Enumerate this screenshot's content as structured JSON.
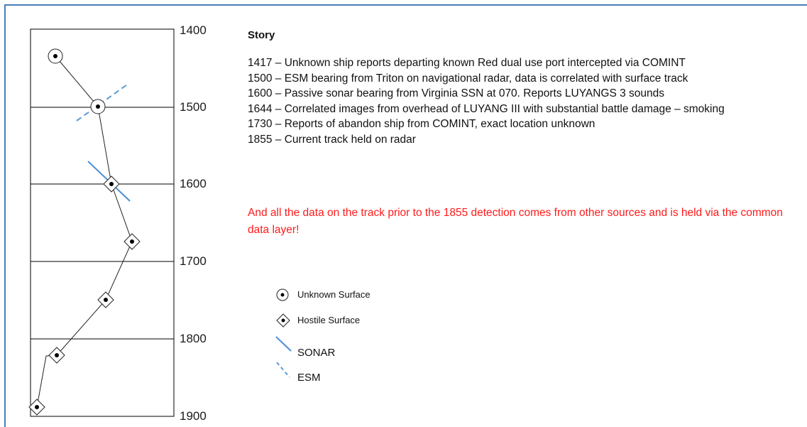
{
  "timeline": {
    "tick_labels": [
      "1400",
      "1500",
      "1600",
      "1700",
      "1800",
      "1900"
    ]
  },
  "story": {
    "title": "Story",
    "lines": [
      "1417 – Unknown ship reports departing known Red dual use port intercepted via COMINT",
      "1500 – ESM bearing from Triton on navigational radar, data is correlated with surface track",
      "1600 – Passive sonar bearing from Virginia SSN at 070. Reports LUYANGS 3 sounds",
      "1644 – Correlated images from overhead of LUYANG III with substantial battle damage – smoking",
      "1730 – Reports of abandon ship from COMINT, exact location unknown",
      "1855 – Current track held on radar"
    ],
    "note": "And all the data on the track prior to the 1855 detection comes from other sources and is held via the common data layer!"
  },
  "legend": {
    "unknown_surface": "Unknown Surface",
    "hostile_surface": "Hostile Surface",
    "sonar": "SONAR",
    "esm": "ESM"
  },
  "colors": {
    "sonar_line": "#4a8fd4",
    "note_text": "#ff1a1a",
    "frame": "#4a7fb5"
  },
  "track": {
    "points": [
      {
        "time": 1417,
        "symbol": "unknown-surface-icon"
      },
      {
        "time": 1500,
        "symbol": "unknown-surface-icon"
      },
      {
        "time": 1600,
        "symbol": "hostile-surface-icon"
      },
      {
        "time": 1674,
        "symbol": "hostile-surface-icon"
      },
      {
        "time": 1750,
        "symbol": "hostile-surface-icon"
      },
      {
        "time": 1823,
        "symbol": "hostile-surface-icon"
      },
      {
        "time": 1890,
        "symbol": "unknown-surface-icon"
      }
    ]
  }
}
